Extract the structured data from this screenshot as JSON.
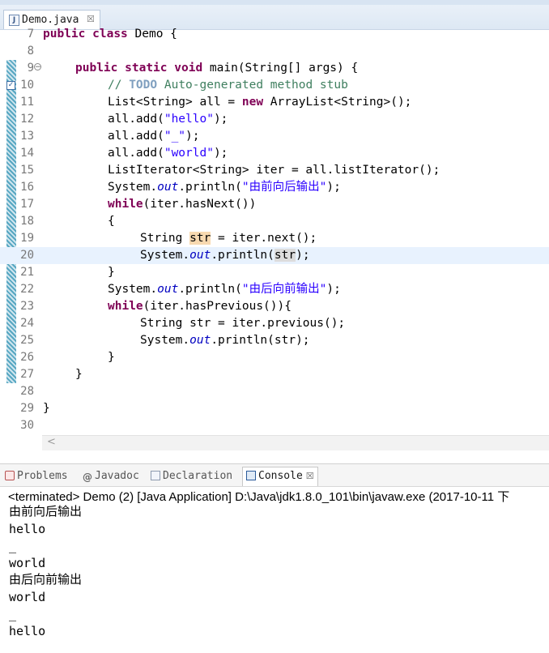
{
  "editor": {
    "tab_icon": "J",
    "tab_title": "Demo.java",
    "tab_close": "☒",
    "fold_marker": "⊖",
    "lines": [
      {
        "num": "7"
      },
      {
        "num": "8"
      },
      {
        "num": "9"
      },
      {
        "num": "10"
      },
      {
        "num": "11"
      },
      {
        "num": "12"
      },
      {
        "num": "13"
      },
      {
        "num": "14"
      },
      {
        "num": "15"
      },
      {
        "num": "16"
      },
      {
        "num": "17"
      },
      {
        "num": "18"
      },
      {
        "num": "19"
      },
      {
        "num": "20"
      },
      {
        "num": "21"
      },
      {
        "num": "22"
      },
      {
        "num": "23"
      },
      {
        "num": "24"
      },
      {
        "num": "25"
      },
      {
        "num": "26"
      },
      {
        "num": "27"
      },
      {
        "num": "28"
      },
      {
        "num": "29"
      },
      {
        "num": "30"
      }
    ],
    "code": {
      "l7_kw1": "public",
      "l7_kw2": "class",
      "l7_rest": " Demo {",
      "l9_kw1": "public",
      "l9_kw2": "static",
      "l9_kw3": "void",
      "l9_rest": " main(String[] args) {",
      "l10_comment": "// ",
      "l10_todo": "TODO",
      "l10_rest": " Auto-generated method stub",
      "l11_a": "List<String> all = ",
      "l11_kw": "new",
      "l11_b": " ArrayList<String>();",
      "l12_a": "all.add(",
      "l12_s": "\"hello\"",
      "l12_b": ");",
      "l13_a": "all.add(",
      "l13_s": "\"_\"",
      "l13_b": ");",
      "l14_a": "all.add(",
      "l14_s": "\"world\"",
      "l14_b": ");",
      "l15": "ListIterator<String> iter = all.listIterator();",
      "l16_a": "System.",
      "l16_f": "out",
      "l16_b": ".println(",
      "l16_s": "\"由前向后输出\"",
      "l16_c": ");",
      "l17_kw": "while",
      "l17_rest": "(iter.hasNext())",
      "l18": "{",
      "l19_a": "String ",
      "l19_v": "str",
      "l19_b": " = iter.next();",
      "l20_a": "System.",
      "l20_f": "out",
      "l20_b": ".println(",
      "l20_v": "str",
      "l20_c": ");",
      "l21": "}",
      "l22_a": "System.",
      "l22_f": "out",
      "l22_b": ".println(",
      "l22_s": "\"由后向前输出\"",
      "l22_c": ");",
      "l23_kw": "while",
      "l23_rest": "(iter.hasPrevious()){",
      "l24": "String str = iter.previous();",
      "l25_a": "System.",
      "l25_f": "out",
      "l25_b": ".println(str);",
      "l26": "}",
      "l27": "}",
      "l29": "}"
    },
    "hscroll_arrow": "<"
  },
  "panel": {
    "tabs": [
      {
        "label": "Problems",
        "icon": "problems-icon"
      },
      {
        "label": "Javadoc",
        "icon": "javadoc-icon",
        "glyph": "@"
      },
      {
        "label": "Declaration",
        "icon": "declaration-icon"
      },
      {
        "label": "Console",
        "icon": "console-icon",
        "active": true,
        "close": "☒"
      }
    ],
    "terminated": "<terminated> Demo (2) [Java Application] D:\\Java\\jdk1.8.0_101\\bin\\javaw.exe (2017-10-11 下",
    "output": [
      "由前向后输出",
      "hello",
      "_",
      "world",
      "由后向前输出",
      "world",
      "_",
      "hello"
    ]
  },
  "colors": {
    "keyword": "#7f0055",
    "string": "#2a00ff",
    "comment": "#3f7f5f",
    "field": "#0000c0",
    "current_line": "#e8f2fe"
  }
}
